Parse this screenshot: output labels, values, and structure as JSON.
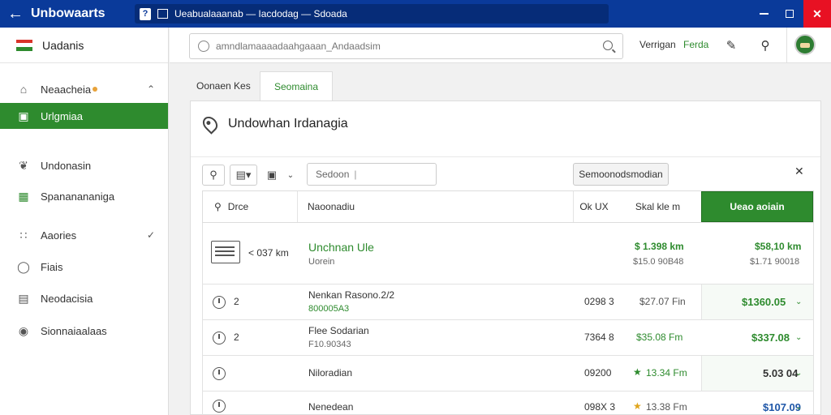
{
  "window": {
    "app_title": "Unbowaarts",
    "address": "Ueabualaaanab — Iacdodag — Sdoada",
    "addr_badge": "?"
  },
  "sidebar": {
    "header": "Uadanis",
    "flag_colors": [
      "#d9332a",
      "#ffffff",
      "#2e8b2e"
    ],
    "items": [
      {
        "label": "Neaacheia",
        "icon": "home-icon",
        "active": false
      },
      {
        "label": "Urlgmiaa",
        "icon": "building-icon",
        "active": true
      },
      {
        "label": "Undonasin",
        "icon": "leaf-icon",
        "active": false
      },
      {
        "label": "Spananananiga",
        "icon": "chart-icon",
        "active": false
      },
      {
        "label": "Aaories",
        "icon": "grid-icon",
        "active": false
      },
      {
        "label": "Fiais",
        "icon": "circle-icon",
        "active": false
      },
      {
        "label": "Neodacisia",
        "icon": "document-icon",
        "active": false
      },
      {
        "label": "Sionnaiaalaas",
        "icon": "settings-icon",
        "active": false
      }
    ]
  },
  "topbar": {
    "search_placeholder": "amndlamaaaadaahgaaan_Andaadsim",
    "link_a": "Verrigan",
    "link_b": "Ferda"
  },
  "tabs": [
    {
      "label": "Oonaen Kes"
    },
    {
      "label": "Seomaina"
    }
  ],
  "panel": {
    "title": "Undowhan Irdanagia",
    "filter_placeholder": "Sedoon",
    "filter_button": "Semoonodsmodian",
    "columns": [
      "Drce",
      "Naoonadiu",
      "Ok UX",
      "Skal kle m",
      "Ueao aoiain"
    ]
  },
  "rows": [
    {
      "c1": "< 037 km",
      "name": "Unchnan Ule",
      "sub": "Uorein",
      "c3": "",
      "price": "$ 1.398 km",
      "price_sub": "$15.0 90B48",
      "total": "$58,10 km",
      "total_sub": "$1.71 90018"
    },
    {
      "c1": "2",
      "name": "Nenkan Rasono.2/2",
      "sub": "800005A3",
      "c3": "0298 3",
      "price": "$27.07 Fin",
      "total": "$1360.05"
    },
    {
      "c1": "2",
      "name": "Flee Sodarian",
      "sub": "F10.90343",
      "c3": "7364 8",
      "price": "$35.08 Fm",
      "total": "$337.08"
    },
    {
      "c1": "",
      "name": "Niloradian",
      "sub": "",
      "c3": "09200",
      "price": "13.34 Fm",
      "total": "5.03 04"
    },
    {
      "c1": "",
      "name": "Nenedean",
      "sub": "",
      "c3": "098X 3",
      "price": "13.38 Fm",
      "total": "$107.09"
    }
  ]
}
